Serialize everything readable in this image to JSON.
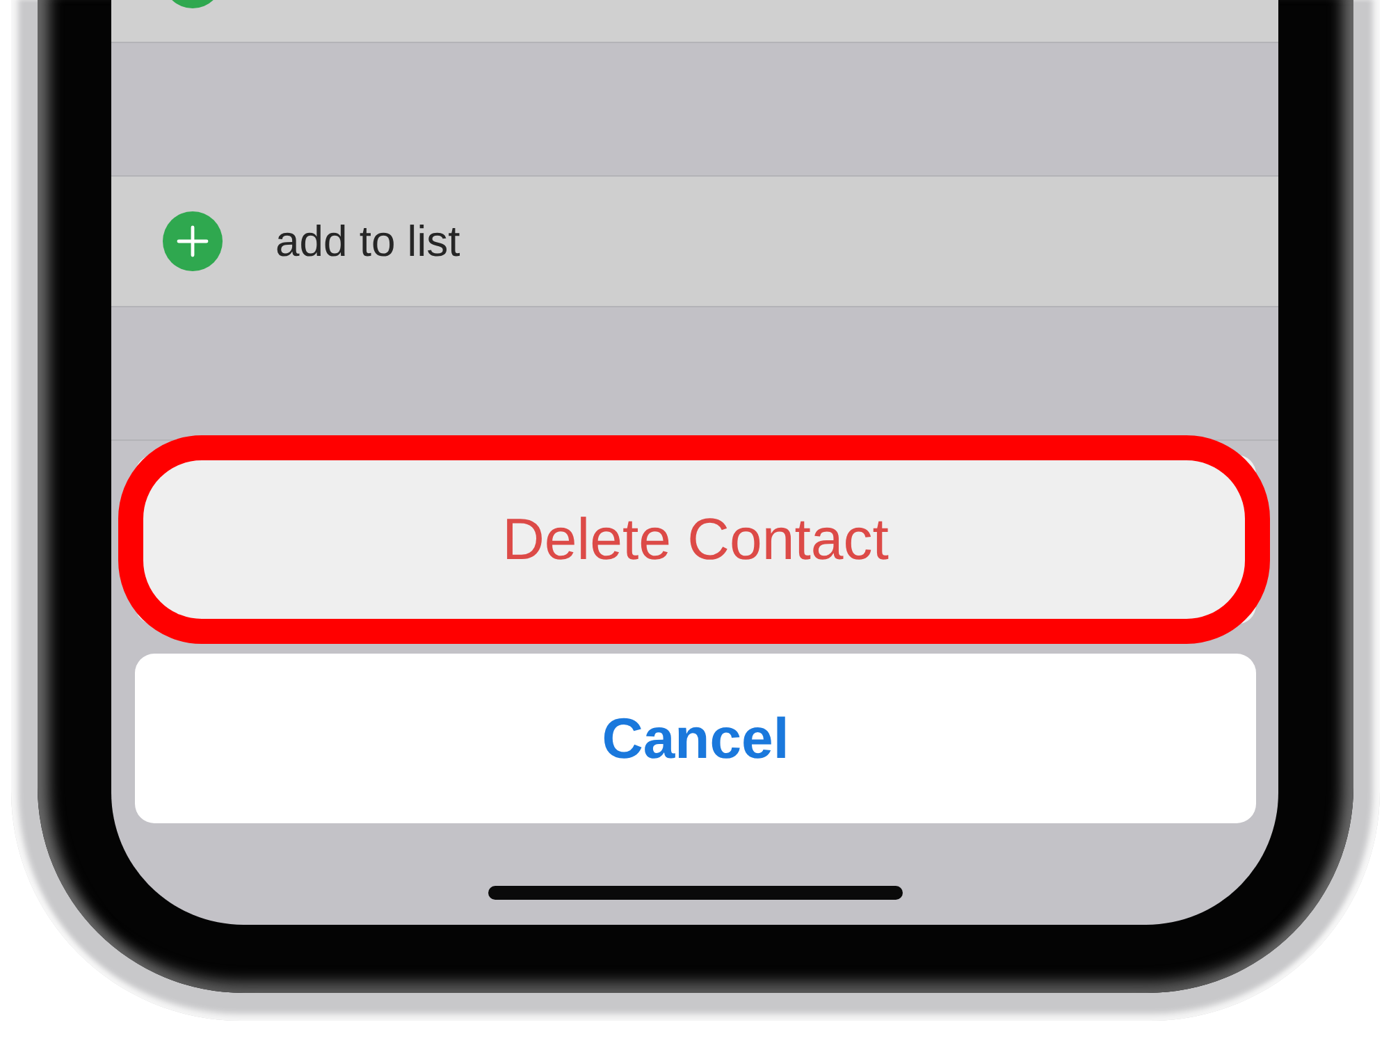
{
  "list": {
    "rows": [
      {
        "kind": "cell_cut"
      },
      {
        "kind": "spacer"
      },
      {
        "kind": "cell",
        "label": "add to list"
      },
      {
        "kind": "spacer"
      }
    ]
  },
  "action_sheet": {
    "actions": [
      {
        "label": "Delete Contact",
        "kind": "destructive",
        "highlighted": true
      },
      {
        "label": "Cancel",
        "kind": "cancel",
        "highlighted": false
      }
    ]
  }
}
